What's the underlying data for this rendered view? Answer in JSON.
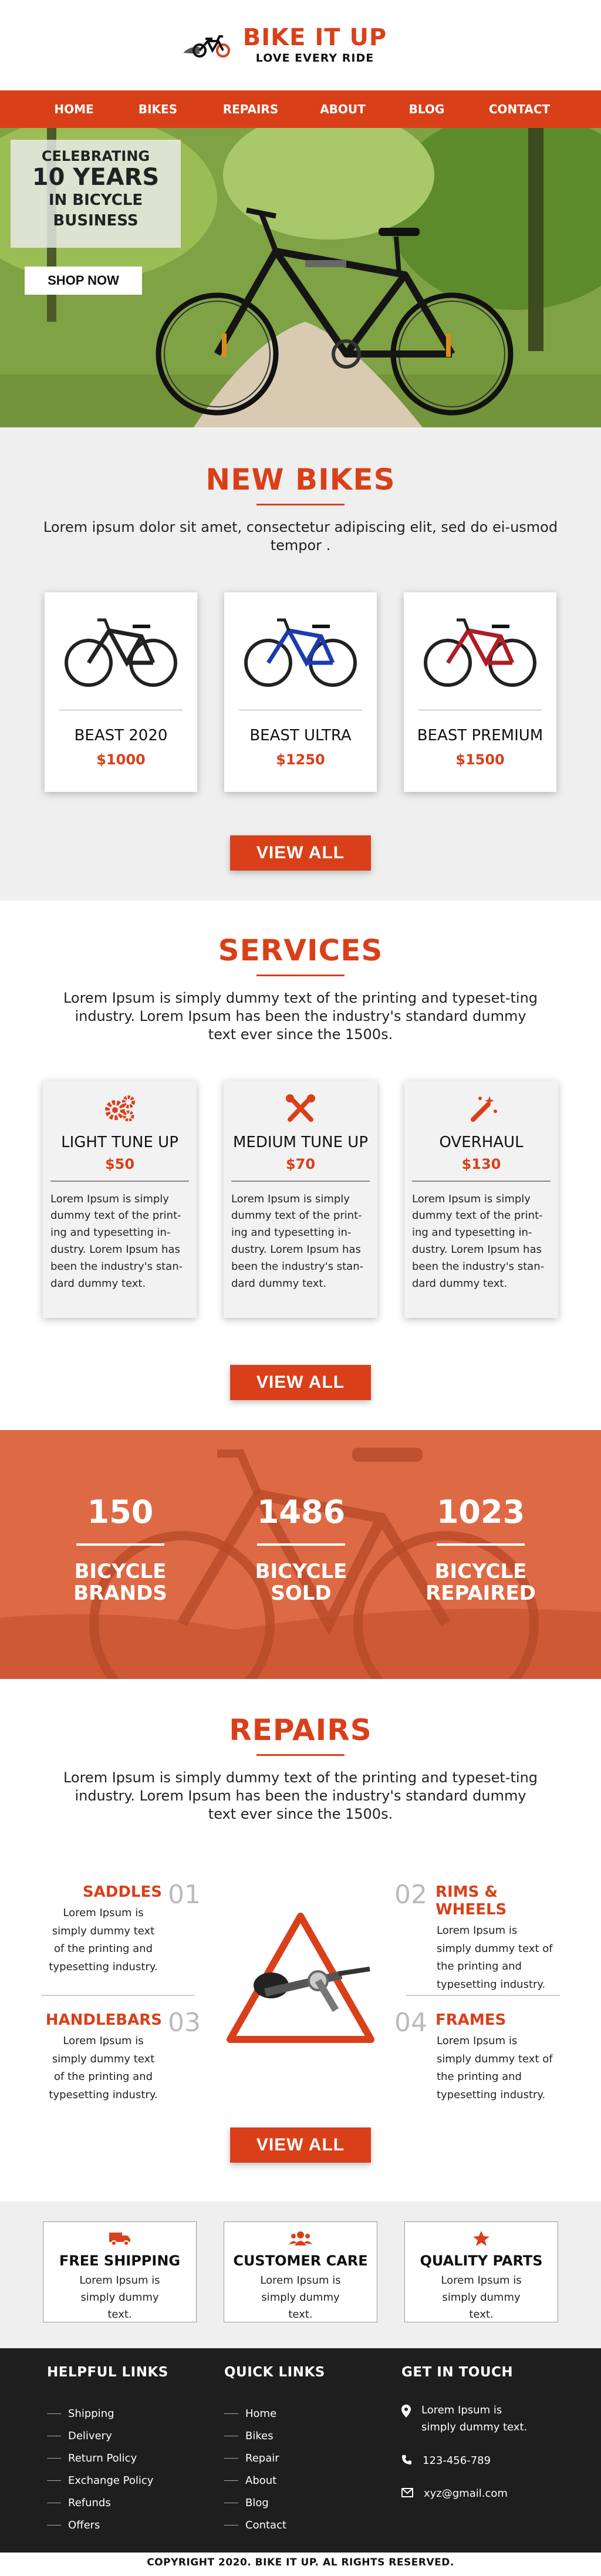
{
  "header": {
    "brand": "BIKE IT UP",
    "tagline": "LOVE EVERY RIDE"
  },
  "nav": [
    "HOME",
    "BIKES",
    "REPAIRS",
    "ABOUT",
    "BLOG",
    "CONTACT"
  ],
  "hero": {
    "line1": "CELEBRATING",
    "line2": "10 YEARS",
    "line3": "IN BICYCLE",
    "line4": "BUSINESS",
    "button": "SHOP NOW"
  },
  "new_bikes": {
    "title": "NEW BIKES",
    "subtitle": "Lorem ipsum dolor sit amet, consectetur adipiscing elit, sed do ei-usmod tempor .",
    "items": [
      {
        "name": "BEAST 2020",
        "price": "$1000",
        "color": "#222222"
      },
      {
        "name": "BEAST ULTRA",
        "price": "$1250",
        "color": "#1c3bb0"
      },
      {
        "name": "BEAST PREMIUM",
        "price": "$1500",
        "color": "#b01c24"
      }
    ],
    "button": "VIEW ALL"
  },
  "services": {
    "title": "SERVICES",
    "subtitle": "Lorem Ipsum is simply dummy text of the printing and typeset-ting industry. Lorem Ipsum has been the industry's standard dummy text ever since the 1500s.",
    "items": [
      {
        "name": "LIGHT TUNE UP",
        "price": "$50",
        "icon": "gears-icon",
        "desc": "Lorem Ipsum is simply dummy text of the print-ing and typesetting in-dustry. Lorem Ipsum has been the industry's stan-dard dummy text."
      },
      {
        "name": "MEDIUM TUNE UP",
        "price": "$70",
        "icon": "tools-icon",
        "desc": "Lorem Ipsum is simply dummy text of the print-ing and typesetting in-dustry. Lorem Ipsum has been the industry's stan-dard dummy text."
      },
      {
        "name": "OVERHAUL",
        "price": "$130",
        "icon": "magic-wand-icon",
        "desc": "Lorem Ipsum is simply dummy text of the print-ing and typesetting in-dustry. Lorem Ipsum has been the industry's stan-dard dummy text."
      }
    ],
    "button": "VIEW ALL"
  },
  "stats": [
    {
      "number": "150",
      "label1": "BICYCLE",
      "label2": "BRANDS"
    },
    {
      "number": "1486",
      "label1": "BICYCLE",
      "label2": "SOLD"
    },
    {
      "number": "1023",
      "label1": "BICYCLE",
      "label2": "REPAIRED"
    }
  ],
  "repairs": {
    "title": "REPAIRS",
    "subtitle": "Lorem Ipsum is simply dummy text of the printing and typeset-ting industry. Lorem Ipsum has been the industry's standard dummy text ever since the 1500s.",
    "items": [
      {
        "num": "01",
        "title": "SADDLES",
        "desc": "Lorem Ipsum is simply dummy text of the printing and typesetting industry."
      },
      {
        "num": "02",
        "title": "RIMS & WHEELS",
        "desc": "Lorem Ipsum is simply dummy text of the printing and typesetting industry."
      },
      {
        "num": "03",
        "title": "HANDLEBARS",
        "desc": "Lorem Ipsum is simply dummy text of the printing and typesetting industry."
      },
      {
        "num": "04",
        "title": "FRAMES",
        "desc": "Lorem Ipsum is simply dummy text of the printing and typesetting industry."
      }
    ],
    "button": "VIEW ALL"
  },
  "features": [
    {
      "title": "FREE SHIPPING",
      "icon": "truck-icon",
      "desc": "Lorem Ipsum is simply dummy text."
    },
    {
      "title": "CUSTOMER CARE",
      "icon": "people-icon",
      "desc": "Lorem Ipsum is simply dummy text."
    },
    {
      "title": "QUALITY PARTS",
      "icon": "star-icon",
      "desc": "Lorem Ipsum is simply dummy text."
    }
  ],
  "footer": {
    "helpful": {
      "title": "HELPFUL LINKS",
      "links": [
        "Shipping",
        "Delivery",
        "Return Policy",
        "Exchange Policy",
        "Refunds",
        "Offers"
      ]
    },
    "quick": {
      "title": "QUICK LINKS",
      "links": [
        "Home",
        "Bikes",
        "Repair",
        "About",
        "Blog",
        "Contact"
      ]
    },
    "contact": {
      "title": "GET IN TOUCH",
      "address": "Lorem Ipsum is simply dummy text.",
      "phone": "123-456-789",
      "email": "xyz@gmail.com"
    },
    "copyright": "COPYRIGHT 2020. BIKE IT UP. AL RIGHTS RESERVED."
  },
  "colors": {
    "accent": "#d9401a",
    "stats_bg": "#de6a45",
    "footer_bg": "#1e1e1e"
  }
}
